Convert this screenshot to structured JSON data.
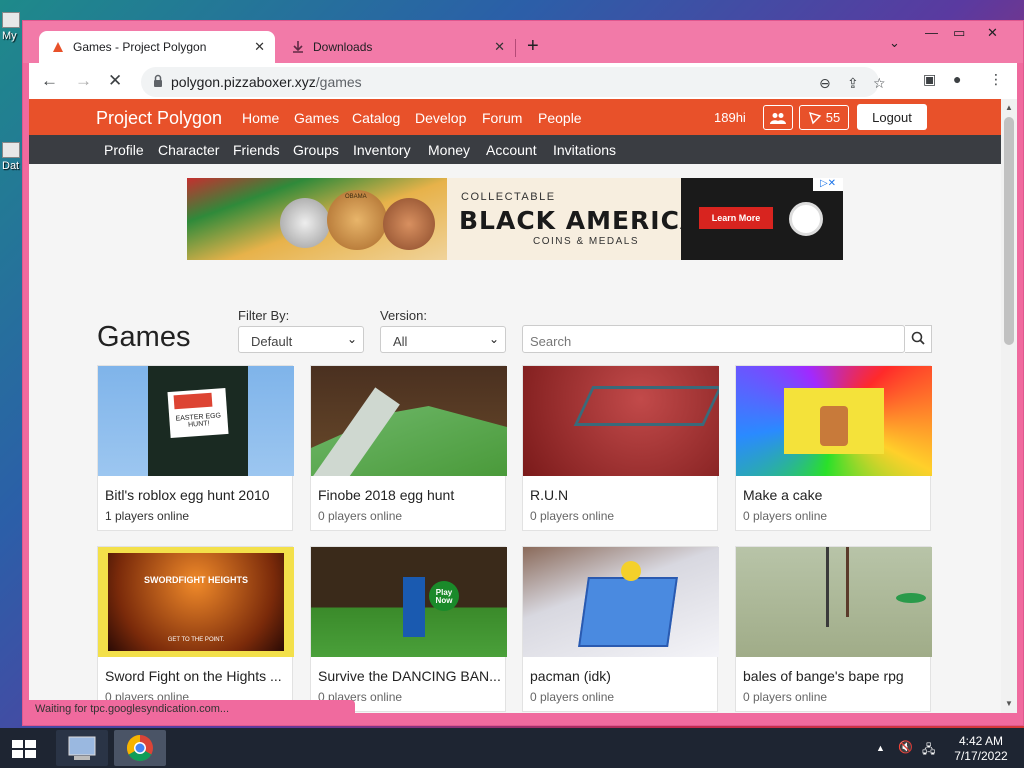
{
  "desktop": {
    "icons": [
      {
        "label": "My"
      },
      {
        "label": "Dat"
      }
    ]
  },
  "browser": {
    "tabs": [
      {
        "label": "Games - Project Polygon",
        "active": true
      },
      {
        "label": "Downloads",
        "active": false
      }
    ],
    "url": {
      "host": "polygon.pizzaboxer.xyz",
      "path": "/games"
    }
  },
  "site": {
    "brand": "Project Polygon",
    "nav": [
      "Home",
      "Games",
      "Catalog",
      "Develop",
      "Forum",
      "People"
    ],
    "username": "189hi",
    "robux_count": "55",
    "logout_label": "Logout",
    "subnav": [
      "Profile",
      "Character",
      "Friends",
      "Groups",
      "Inventory",
      "Money",
      "Account",
      "Invitations"
    ]
  },
  "ad": {
    "line1": "COLLECTABLE",
    "line2": "BLACK AMERICAN",
    "line3": "COINS & MEDALS",
    "button": "Learn More",
    "coin_text": "OBAMA"
  },
  "games": {
    "title": "Games",
    "filter_label": "Filter By:",
    "filter_value": "Default",
    "version_label": "Version:",
    "version_value": "All",
    "search_placeholder": "Search",
    "items": [
      {
        "name": "Bitl's roblox egg hunt 2010",
        "online": "1 players online",
        "thumb_text": "EASTER EGG HUNT!"
      },
      {
        "name": "Finobe 2018 egg hunt",
        "online": "0 players online"
      },
      {
        "name": "R.U.N",
        "online": "0 players online"
      },
      {
        "name": "Make a cake",
        "online": "0 players online"
      },
      {
        "name": "Sword Fight on the Hights ...",
        "online": "0 players online",
        "thumb_text": "SWORDFIGHT HEIGHTS",
        "thumb_sub": "GET TO THE POINT."
      },
      {
        "name": "Survive the DANCING BAN...",
        "online": "0 players online",
        "thumb_text": "Play Now"
      },
      {
        "name": "pacman (idk)",
        "online": "0 players online"
      },
      {
        "name": "bales of bange's bape rpg",
        "online": "0 players online"
      }
    ]
  },
  "status_text": "Waiting for tpc.googlesyndication.com...",
  "clock": {
    "time": "4:42 AM",
    "date": "7/17/2022"
  },
  "colors": {
    "nav": "#e8512a",
    "subnav": "#3a3d42",
    "window_frame": "#f06a9e"
  }
}
